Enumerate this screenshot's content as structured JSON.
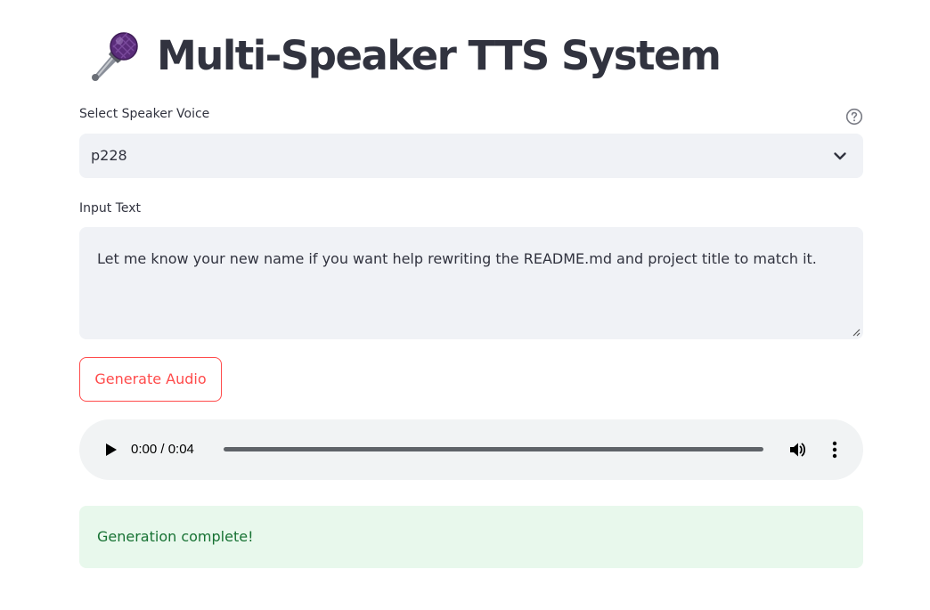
{
  "header": {
    "title": "Multi-Speaker TTS System",
    "icon": "microphone-icon"
  },
  "speaker_select": {
    "label": "Select Speaker Voice",
    "selected_value": "p228",
    "help_icon": "question-circle-icon",
    "dropdown_icon": "chevron-down-icon"
  },
  "input_text": {
    "label": "Input Text",
    "value": "Let me know your new name if you want help rewriting the README.md and project title to match it."
  },
  "generate_button": {
    "label": "Generate Audio"
  },
  "audio_player": {
    "time": "0:00 / 0:04",
    "progress": 0.0
  },
  "status": {
    "message": "Generation complete!"
  },
  "colors": {
    "accent": "#ff4b4b",
    "text": "#31333f",
    "input_bg": "#f0f2f6",
    "success_bg": "#e8f8ec",
    "success_text": "#177233"
  }
}
